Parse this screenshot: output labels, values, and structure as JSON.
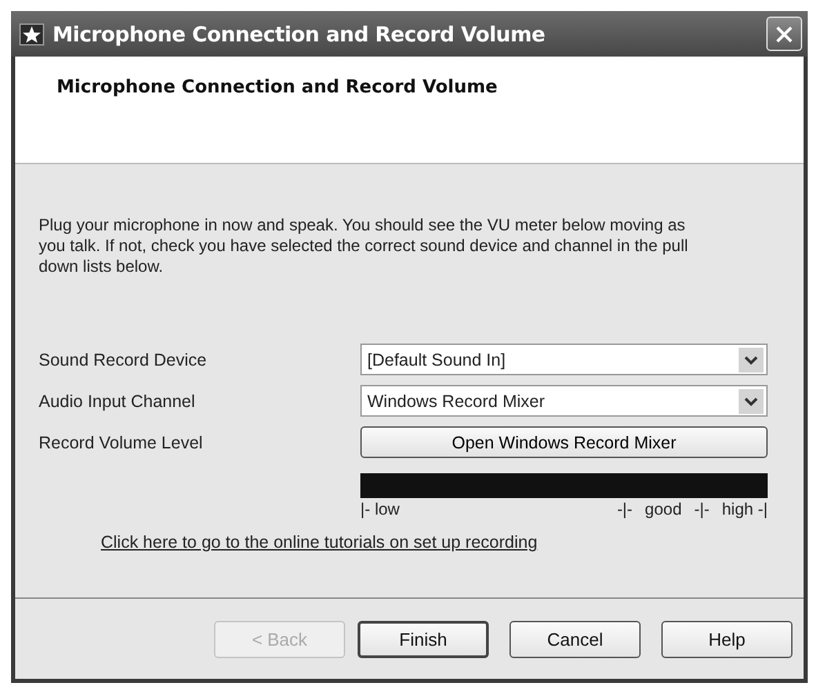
{
  "window": {
    "title": "Microphone Connection and Record Volume"
  },
  "header": {
    "title": "Microphone Connection and Record Volume"
  },
  "instructions": "Plug your microphone in now and speak. You should see the VU meter below moving as you talk. If not, check you have selected the correct sound device and channel in the pull down lists below.",
  "fields": [
    {
      "kind": "dropdown",
      "label": "Sound Record Device",
      "value": "[Default Sound In]"
    },
    {
      "kind": "dropdown",
      "label": "Audio Input Channel",
      "value": "Windows Record Mixer"
    },
    {
      "kind": "button",
      "label": "Record Volume Level",
      "button": "Open Windows Record Mixer"
    }
  ],
  "vu_meter": {
    "level": 0,
    "scale": [
      "|- low",
      "-|-",
      "good",
      "-|-",
      "high -|"
    ]
  },
  "link": "Click here to go to the online tutorials on set up recording",
  "buttons": [
    {
      "label": "< Back",
      "disabled": true,
      "default": false
    },
    {
      "label": "Finish",
      "disabled": false,
      "default": true
    },
    {
      "label": "Cancel",
      "disabled": false,
      "default": false
    },
    {
      "label": "Help",
      "disabled": false,
      "default": false
    }
  ]
}
